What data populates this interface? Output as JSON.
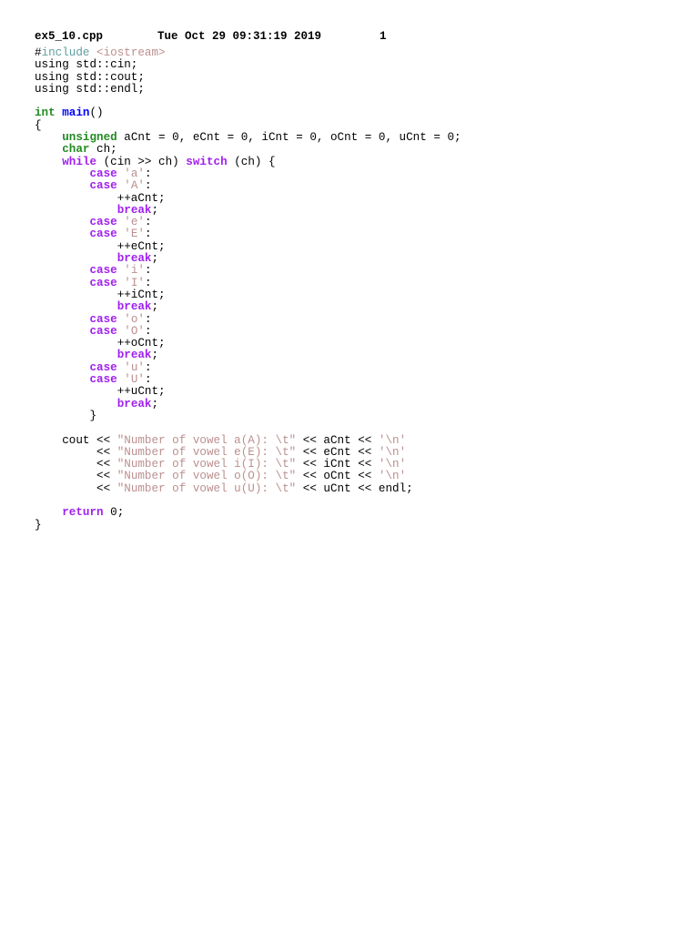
{
  "header": {
    "filename": "ex5_10.cpp",
    "datetime": "Tue Oct 29 09:31:19 2019",
    "page_number": "1"
  },
  "colors": {
    "keyword": "#a020f0",
    "type": "#228b22",
    "function": "#0000ff",
    "string": "#bc8f8f",
    "preprocessor": "#5f9ea0",
    "plain": "#000000"
  },
  "code_lines": [
    [
      {
        "t": "#",
        "c": "plain"
      },
      {
        "t": "include",
        "c": "preproc"
      },
      {
        "t": " ",
        "c": "plain"
      },
      {
        "t": "<iostream>",
        "c": "string"
      }
    ],
    [
      {
        "t": "using std::cin;",
        "c": "plain"
      }
    ],
    [
      {
        "t": "using std::cout;",
        "c": "plain"
      }
    ],
    [
      {
        "t": "using std::endl;",
        "c": "plain"
      }
    ],
    [],
    [
      {
        "t": "int",
        "c": "type"
      },
      {
        "t": " ",
        "c": "plain"
      },
      {
        "t": "main",
        "c": "func"
      },
      {
        "t": "()",
        "c": "plain"
      }
    ],
    [
      {
        "t": "{",
        "c": "plain"
      }
    ],
    [
      {
        "t": "    ",
        "c": "plain"
      },
      {
        "t": "unsigned",
        "c": "type"
      },
      {
        "t": " aCnt = 0, eCnt = 0, iCnt = 0, oCnt = 0, uCnt = 0;",
        "c": "plain"
      }
    ],
    [
      {
        "t": "    ",
        "c": "plain"
      },
      {
        "t": "char",
        "c": "type"
      },
      {
        "t": " ch;",
        "c": "plain"
      }
    ],
    [
      {
        "t": "    ",
        "c": "plain"
      },
      {
        "t": "while",
        "c": "keyword"
      },
      {
        "t": " (cin >> ch) ",
        "c": "plain"
      },
      {
        "t": "switch",
        "c": "keyword"
      },
      {
        "t": " (ch) {",
        "c": "plain"
      }
    ],
    [
      {
        "t": "        ",
        "c": "plain"
      },
      {
        "t": "case",
        "c": "keyword"
      },
      {
        "t": " ",
        "c": "plain"
      },
      {
        "t": "'a'",
        "c": "string"
      },
      {
        "t": ":",
        "c": "plain"
      }
    ],
    [
      {
        "t": "        ",
        "c": "plain"
      },
      {
        "t": "case",
        "c": "keyword"
      },
      {
        "t": " ",
        "c": "plain"
      },
      {
        "t": "'A'",
        "c": "string"
      },
      {
        "t": ":",
        "c": "plain"
      }
    ],
    [
      {
        "t": "            ++aCnt;",
        "c": "plain"
      }
    ],
    [
      {
        "t": "            ",
        "c": "plain"
      },
      {
        "t": "break",
        "c": "keyword"
      },
      {
        "t": ";",
        "c": "plain"
      }
    ],
    [
      {
        "t": "        ",
        "c": "plain"
      },
      {
        "t": "case",
        "c": "keyword"
      },
      {
        "t": " ",
        "c": "plain"
      },
      {
        "t": "'e'",
        "c": "string"
      },
      {
        "t": ":",
        "c": "plain"
      }
    ],
    [
      {
        "t": "        ",
        "c": "plain"
      },
      {
        "t": "case",
        "c": "keyword"
      },
      {
        "t": " ",
        "c": "plain"
      },
      {
        "t": "'E'",
        "c": "string"
      },
      {
        "t": ":",
        "c": "plain"
      }
    ],
    [
      {
        "t": "            ++eCnt;",
        "c": "plain"
      }
    ],
    [
      {
        "t": "            ",
        "c": "plain"
      },
      {
        "t": "break",
        "c": "keyword"
      },
      {
        "t": ";",
        "c": "plain"
      }
    ],
    [
      {
        "t": "        ",
        "c": "plain"
      },
      {
        "t": "case",
        "c": "keyword"
      },
      {
        "t": " ",
        "c": "plain"
      },
      {
        "t": "'i'",
        "c": "string"
      },
      {
        "t": ":",
        "c": "plain"
      }
    ],
    [
      {
        "t": "        ",
        "c": "plain"
      },
      {
        "t": "case",
        "c": "keyword"
      },
      {
        "t": " ",
        "c": "plain"
      },
      {
        "t": "'I'",
        "c": "string"
      },
      {
        "t": ":",
        "c": "plain"
      }
    ],
    [
      {
        "t": "            ++iCnt;",
        "c": "plain"
      }
    ],
    [
      {
        "t": "            ",
        "c": "plain"
      },
      {
        "t": "break",
        "c": "keyword"
      },
      {
        "t": ";",
        "c": "plain"
      }
    ],
    [
      {
        "t": "        ",
        "c": "plain"
      },
      {
        "t": "case",
        "c": "keyword"
      },
      {
        "t": " ",
        "c": "plain"
      },
      {
        "t": "'o'",
        "c": "string"
      },
      {
        "t": ":",
        "c": "plain"
      }
    ],
    [
      {
        "t": "        ",
        "c": "plain"
      },
      {
        "t": "case",
        "c": "keyword"
      },
      {
        "t": " ",
        "c": "plain"
      },
      {
        "t": "'O'",
        "c": "string"
      },
      {
        "t": ":",
        "c": "plain"
      }
    ],
    [
      {
        "t": "            ++oCnt;",
        "c": "plain"
      }
    ],
    [
      {
        "t": "            ",
        "c": "plain"
      },
      {
        "t": "break",
        "c": "keyword"
      },
      {
        "t": ";",
        "c": "plain"
      }
    ],
    [
      {
        "t": "        ",
        "c": "plain"
      },
      {
        "t": "case",
        "c": "keyword"
      },
      {
        "t": " ",
        "c": "plain"
      },
      {
        "t": "'u'",
        "c": "string"
      },
      {
        "t": ":",
        "c": "plain"
      }
    ],
    [
      {
        "t": "        ",
        "c": "plain"
      },
      {
        "t": "case",
        "c": "keyword"
      },
      {
        "t": " ",
        "c": "plain"
      },
      {
        "t": "'U'",
        "c": "string"
      },
      {
        "t": ":",
        "c": "plain"
      }
    ],
    [
      {
        "t": "            ++uCnt;",
        "c": "plain"
      }
    ],
    [
      {
        "t": "            ",
        "c": "plain"
      },
      {
        "t": "break",
        "c": "keyword"
      },
      {
        "t": ";",
        "c": "plain"
      }
    ],
    [
      {
        "t": "        }",
        "c": "plain"
      }
    ],
    [],
    [
      {
        "t": "    cout << ",
        "c": "plain"
      },
      {
        "t": "\"Number of vowel a(A): \\t\"",
        "c": "string"
      },
      {
        "t": " << aCnt << ",
        "c": "plain"
      },
      {
        "t": "'\\n'",
        "c": "string"
      }
    ],
    [
      {
        "t": "         << ",
        "c": "plain"
      },
      {
        "t": "\"Number of vowel e(E): \\t\"",
        "c": "string"
      },
      {
        "t": " << eCnt << ",
        "c": "plain"
      },
      {
        "t": "'\\n'",
        "c": "string"
      }
    ],
    [
      {
        "t": "         << ",
        "c": "plain"
      },
      {
        "t": "\"Number of vowel i(I): \\t\"",
        "c": "string"
      },
      {
        "t": " << iCnt << ",
        "c": "plain"
      },
      {
        "t": "'\\n'",
        "c": "string"
      }
    ],
    [
      {
        "t": "         << ",
        "c": "plain"
      },
      {
        "t": "\"Number of vowel o(O): \\t\"",
        "c": "string"
      },
      {
        "t": " << oCnt << ",
        "c": "plain"
      },
      {
        "t": "'\\n'",
        "c": "string"
      }
    ],
    [
      {
        "t": "         << ",
        "c": "plain"
      },
      {
        "t": "\"Number of vowel u(U): \\t\"",
        "c": "string"
      },
      {
        "t": " << uCnt << endl;",
        "c": "plain"
      }
    ],
    [],
    [
      {
        "t": "    ",
        "c": "plain"
      },
      {
        "t": "return",
        "c": "keyword"
      },
      {
        "t": " 0;",
        "c": "plain"
      }
    ],
    [
      {
        "t": "}",
        "c": "plain"
      }
    ]
  ]
}
